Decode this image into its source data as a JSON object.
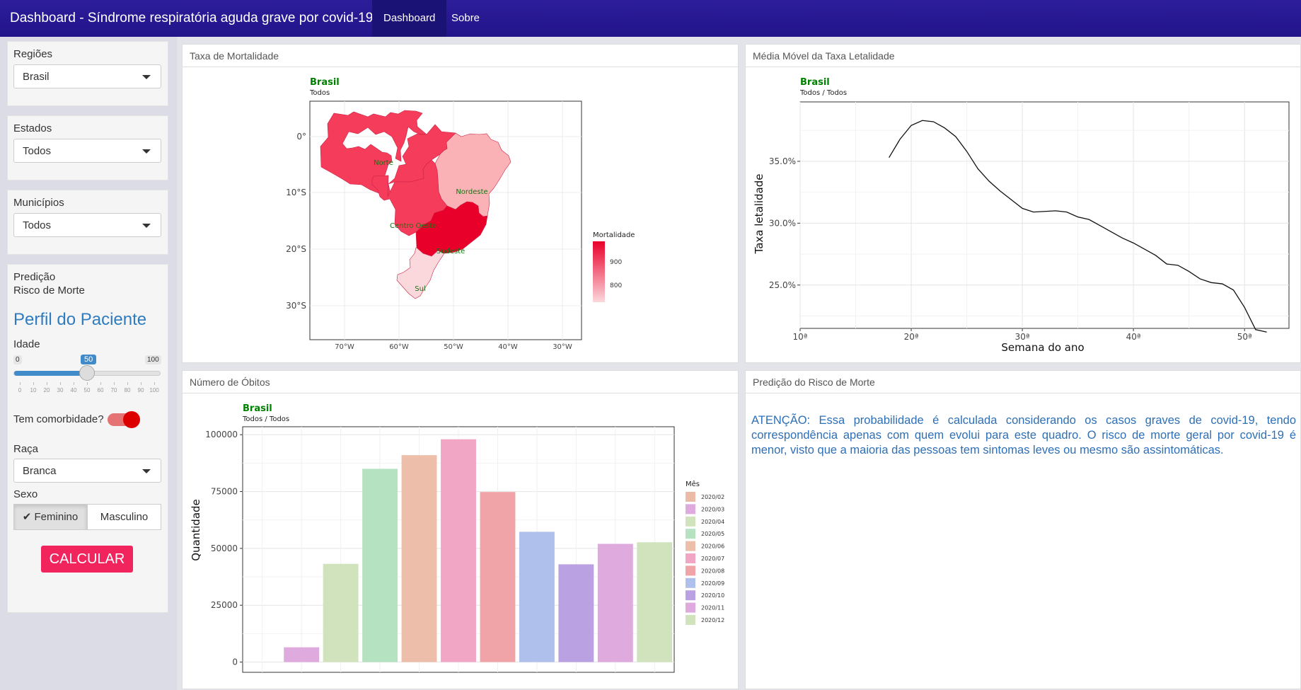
{
  "navbar": {
    "title": "Dashboard - Síndrome respiratória aguda grave por covid-19",
    "tabs": [
      {
        "label": "Dashboard",
        "active": true
      },
      {
        "label": "Sobre",
        "active": false
      }
    ]
  },
  "sidebar": {
    "regioes": {
      "label": "Regiões",
      "value": "Brasil"
    },
    "estados": {
      "label": "Estados",
      "value": "Todos"
    },
    "municipios": {
      "label": "Municípios",
      "value": "Todos"
    },
    "predicao_label": "Predição",
    "risco_label": "Risco de Morte",
    "perfil_title": "Perfil do Paciente",
    "idade": {
      "label": "Idade",
      "min": 0,
      "max": 100,
      "value": 50,
      "min_label": "0",
      "max_label": "100",
      "value_label": "50",
      "ticks": [
        "0",
        "10",
        "20",
        "30",
        "40",
        "50",
        "60",
        "70",
        "80",
        "90",
        "100"
      ]
    },
    "comorbidade": {
      "label": "Tem comorbidade?",
      "checked": true
    },
    "raca": {
      "label": "Raça",
      "value": "Branca"
    },
    "sexo": {
      "label": "Sexo",
      "options": [
        "Feminino",
        "Masculino"
      ],
      "selected": "Feminino"
    },
    "calc_button": "CALCULAR"
  },
  "panels": {
    "mortalidade": {
      "heading": "Taxa de Mortalidade",
      "title": "Brasil",
      "subtitle": "Todos",
      "legend_title": "Mortalidade",
      "legend_ticks": [
        "900",
        "800"
      ],
      "regions": [
        "Norte",
        "Nordeste",
        "Centro Oeste",
        "Sudeste",
        "Sul"
      ],
      "lat_ticks": [
        "0°",
        "10°S",
        "20°S",
        "30°S"
      ],
      "lon_ticks": [
        "70°W",
        "60°W",
        "50°W",
        "40°W",
        "30°W"
      ]
    },
    "letalidade": {
      "heading": "Média Móvel da Taxa Letalidade",
      "title": "Brasil",
      "subtitle": "Todos / Todos",
      "xlabel": "Semana do ano",
      "ylabel": "Taxa letalidade",
      "x_ticks": [
        "10ª",
        "20ª",
        "30ª",
        "40ª",
        "50ª"
      ],
      "y_ticks": [
        "35.0%",
        "30.0%",
        "25.0%"
      ]
    },
    "obitos": {
      "heading": "Número de Óbitos",
      "title": "Brasil",
      "subtitle": "Todos / Todos",
      "ylabel": "Quantidade",
      "legend_title": "Mês",
      "y_ticks": [
        "100000",
        "75000",
        "50000",
        "25000",
        "0"
      ]
    },
    "predicao": {
      "heading": "Predição do Risco de Morte",
      "warning": "ATENÇÃO: Essa probabilidade é calculada considerando os casos graves de covid-19, tendo correspondência apenas com quem evolui para este quadro. O risco de morte geral por covid-19 é menor, visto que a maioria das pessoas tem sintomas leves ou mesmo são assintomáticas."
    }
  },
  "chart_data": [
    {
      "type": "line",
      "title": "Brasil",
      "subtitle": "Todos / Todos",
      "xlabel": "Semana do ano",
      "ylabel": "Taxa letalidade",
      "xlim": [
        10,
        54
      ],
      "ylim": [
        21.5,
        39.8
      ],
      "grid": true,
      "x": [
        18,
        19,
        20,
        21,
        22,
        23,
        24,
        25,
        26,
        27,
        28,
        29,
        30,
        31,
        32,
        33,
        34,
        35,
        36,
        37,
        38,
        39,
        40,
        41,
        42,
        43,
        44,
        45,
        46,
        47,
        48,
        49,
        50,
        51,
        52
      ],
      "y": [
        35.3,
        36.8,
        37.9,
        38.3,
        38.2,
        37.7,
        37.0,
        35.8,
        34.4,
        33.4,
        32.6,
        31.9,
        31.2,
        30.9,
        30.95,
        31.0,
        30.9,
        30.5,
        30.3,
        29.8,
        29.3,
        28.8,
        28.4,
        27.9,
        27.4,
        26.7,
        26.6,
        26.1,
        25.5,
        25.2,
        25.1,
        24.6,
        23.2,
        21.4,
        21.2
      ]
    },
    {
      "type": "bar",
      "title": "Brasil",
      "subtitle": "Todos / Todos",
      "ylabel": "Quantidade",
      "ylim": [
        -4500,
        103500
      ],
      "grid": true,
      "legend_title": "Mês",
      "legend_position": "right",
      "categories": [
        "2020/02",
        "2020/03",
        "2020/04",
        "2020/05",
        "2020/06",
        "2020/07",
        "2020/08",
        "2020/09",
        "2020/10",
        "2020/11",
        "2020/12"
      ],
      "values": [
        0,
        6500,
        43200,
        85000,
        91000,
        98000,
        74800,
        57300,
        43000,
        52000,
        52700
      ],
      "colors": [
        "#ecbba8",
        "#dfaade",
        "#d1e3bd",
        "#b5e2c0",
        "#edbfaa",
        "#f2a6c6",
        "#f1a4a8",
        "#afc0ec",
        "#baa2e2",
        "#dfaade",
        "#d1e3bd"
      ]
    }
  ],
  "colors": {
    "navbar": "#22148a",
    "accent_red": "#dd0000",
    "calc_button": "#f2245e",
    "title_green": "#008000",
    "link_blue": "#2e6fb5"
  }
}
